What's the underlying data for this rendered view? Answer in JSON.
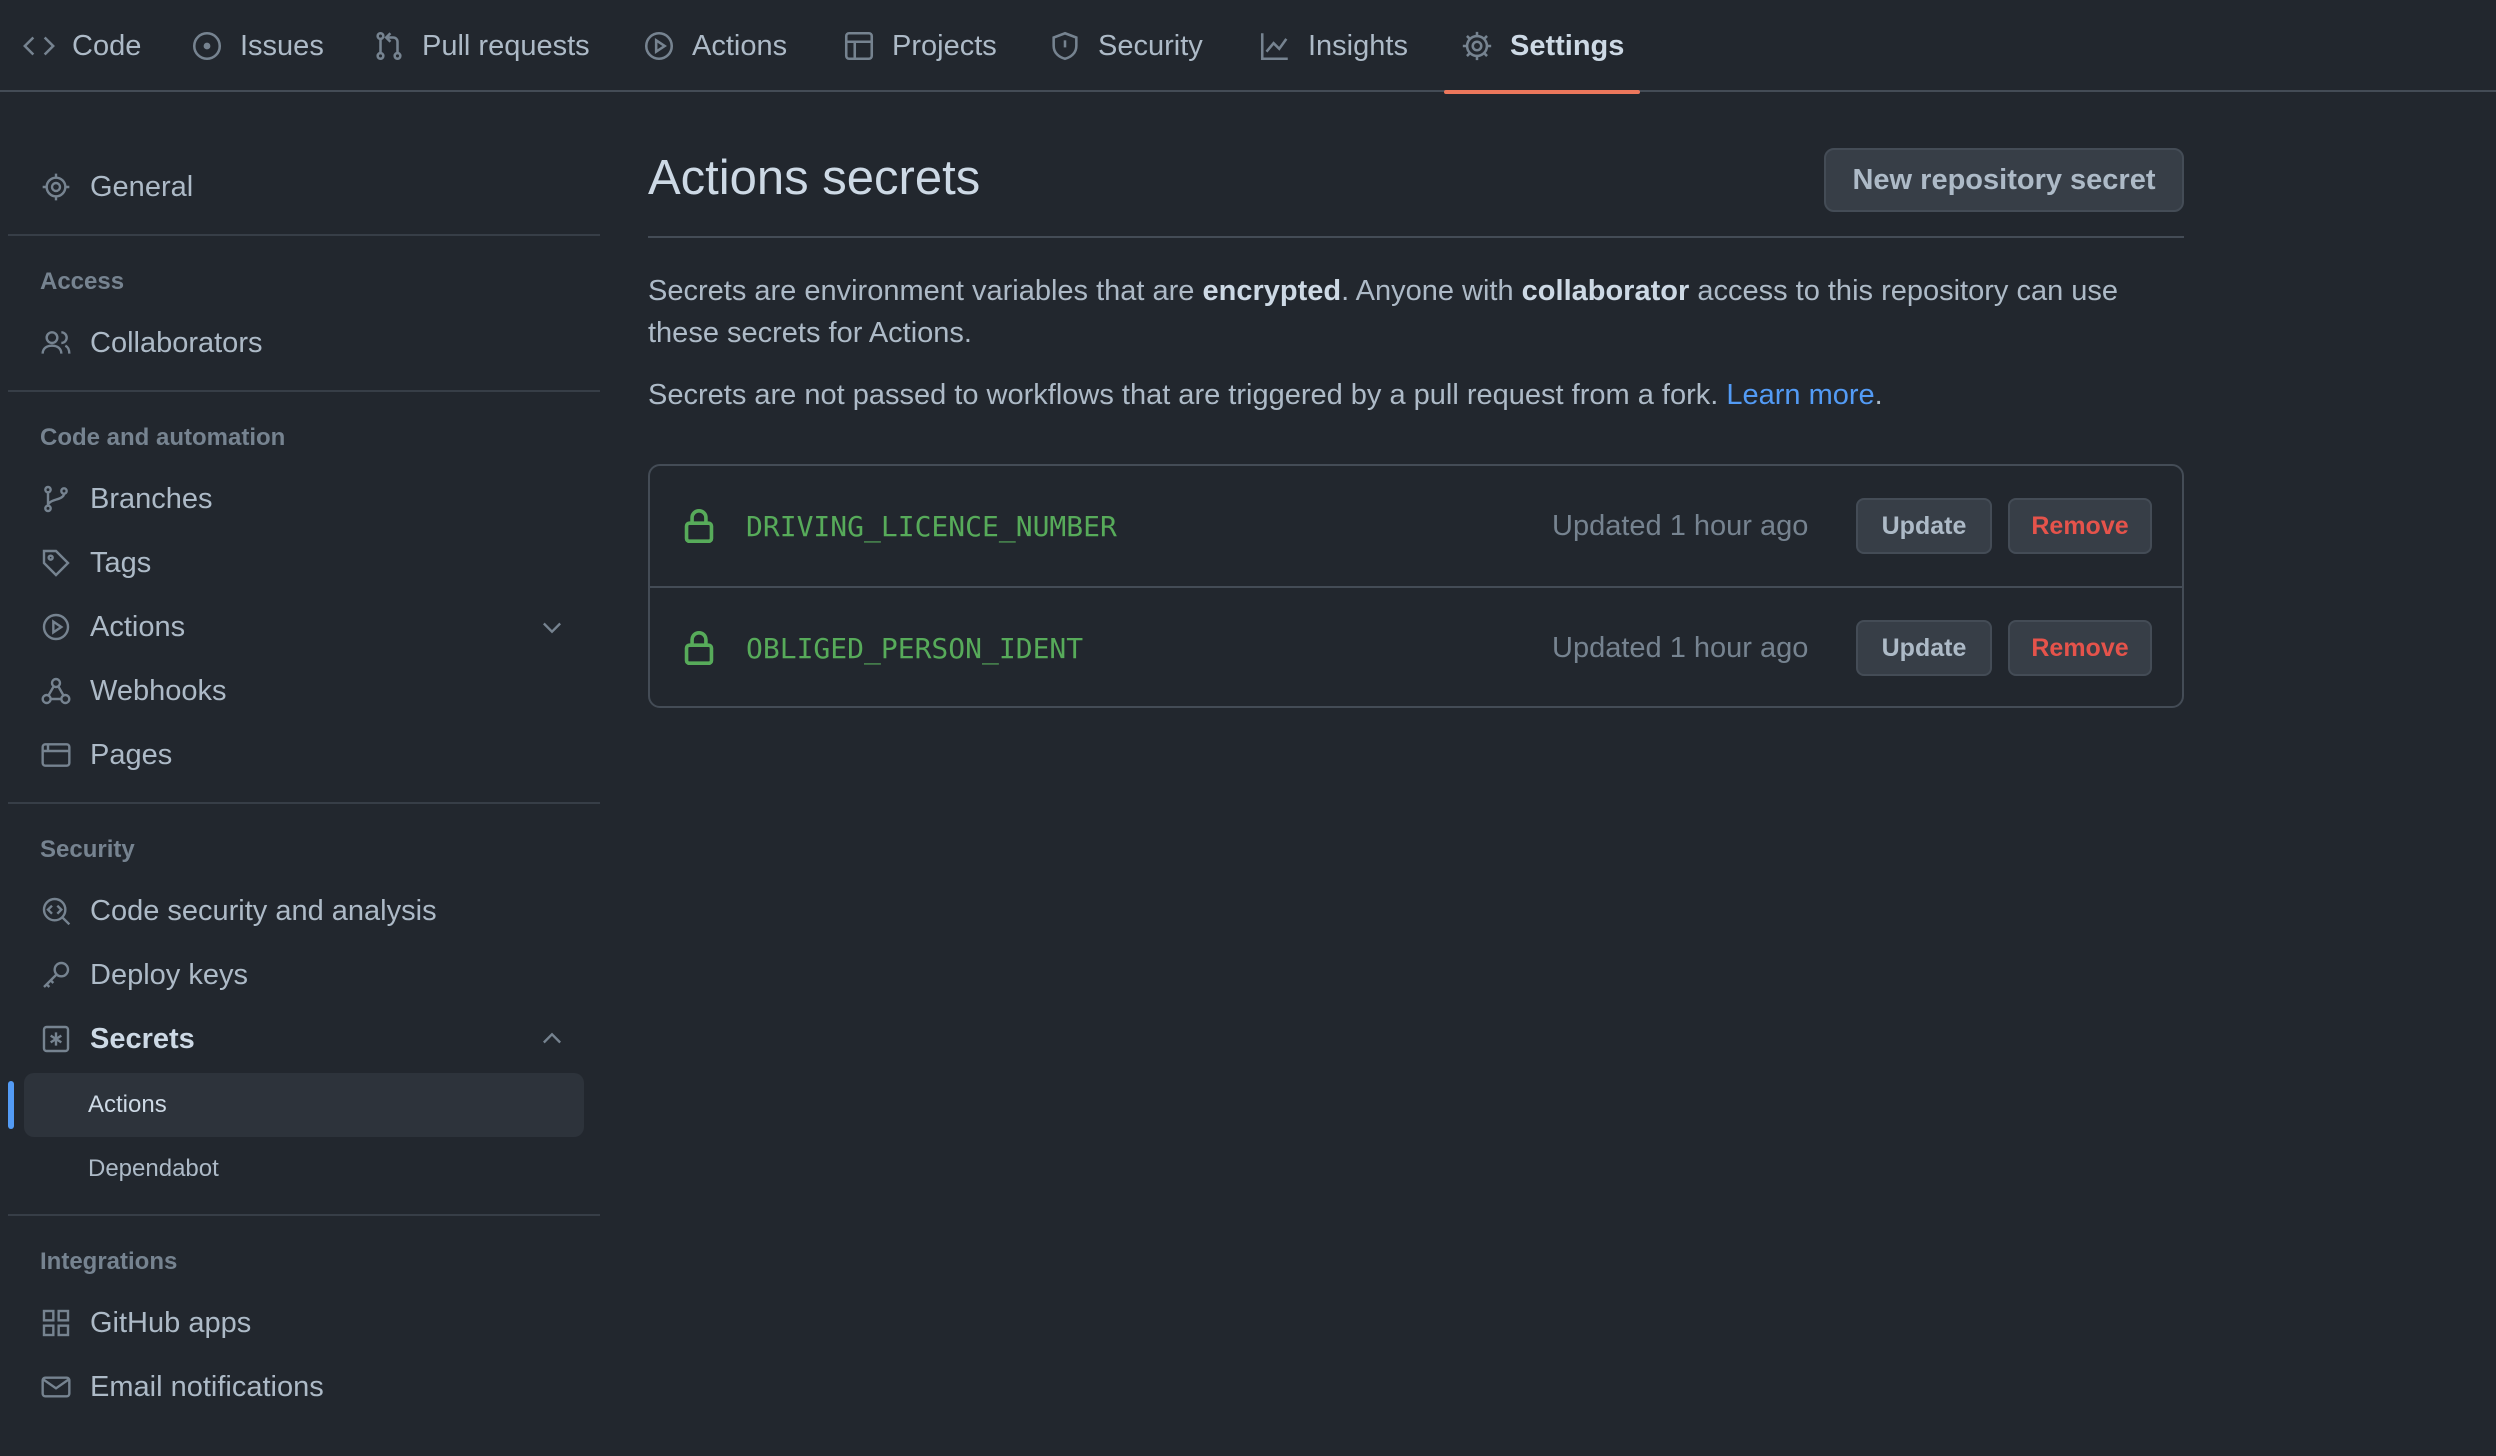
{
  "nav": {
    "tabs": [
      {
        "label": "Code",
        "icon": "code-icon"
      },
      {
        "label": "Issues",
        "icon": "issue-opened-icon"
      },
      {
        "label": "Pull requests",
        "icon": "git-pull-request-icon"
      },
      {
        "label": "Actions",
        "icon": "play-icon"
      },
      {
        "label": "Projects",
        "icon": "table-icon"
      },
      {
        "label": "Security",
        "icon": "shield-icon"
      },
      {
        "label": "Insights",
        "icon": "graph-icon"
      },
      {
        "label": "Settings",
        "icon": "gear-icon",
        "selected": true
      }
    ]
  },
  "sidebar": {
    "general": "General",
    "access_heading": "Access",
    "collaborators": "Collaborators",
    "automation_heading": "Code and automation",
    "branches": "Branches",
    "tags": "Tags",
    "actions": "Actions",
    "webhooks": "Webhooks",
    "pages": "Pages",
    "security_heading": "Security",
    "code_security": "Code security and analysis",
    "deploy_keys": "Deploy keys",
    "secrets": "Secrets",
    "secrets_actions": "Actions",
    "secrets_dependabot": "Dependabot",
    "integrations_heading": "Integrations",
    "github_apps": "GitHub apps",
    "email_notifications": "Email notifications"
  },
  "main": {
    "title": "Actions secrets",
    "new_secret_button": "New repository secret",
    "desc1_a": "Secrets are environment variables that are ",
    "desc1_b": "encrypted",
    "desc1_c": ". Anyone with ",
    "desc1_d": "collaborator",
    "desc1_e": " access to this repository can use these secrets for Actions.",
    "desc2": "Secrets are not passed to workflows that are triggered by a pull request from a fork. ",
    "learn_more": "Learn more",
    "desc2_end": ".",
    "secrets": [
      {
        "name": "DRIVING_LICENCE_NUMBER",
        "updated": "Updated 1 hour ago",
        "update_label": "Update",
        "remove_label": "Remove"
      },
      {
        "name": "OBLIGED_PERSON_IDENT",
        "updated": "Updated 1 hour ago",
        "update_label": "Update",
        "remove_label": "Remove"
      }
    ]
  },
  "colors": {
    "background": "#22272e",
    "accent_underline": "#ec775c",
    "link": "#539bf5",
    "secret_name": "#57ab5a",
    "danger": "#e5534b"
  }
}
